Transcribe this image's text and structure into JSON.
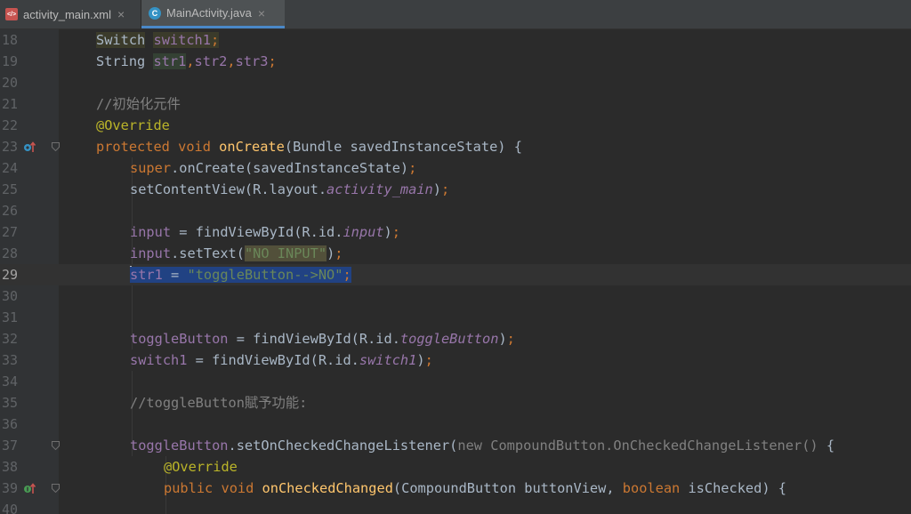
{
  "tabs": [
    {
      "label": "activity_main.xml",
      "icon": "xml-file-icon",
      "close": "×",
      "active": false
    },
    {
      "label": "MainActivity.java",
      "icon": "java-class-icon",
      "close": "×",
      "active": true
    }
  ],
  "editor": {
    "language": "java",
    "current_line": 29,
    "colors": {
      "background": "#2b2b2b",
      "keyword": "#cc7832",
      "field": "#9876aa",
      "method": "#ffc66d",
      "string": "#6a8759",
      "annotation": "#bbb529",
      "comment": "#808080",
      "selection": "#214283"
    },
    "lines": [
      {
        "n": "18",
        "t": [
          "Switch",
          " ",
          "switch1",
          ";"
        ]
      },
      {
        "n": "19",
        "t": [
          "String ",
          "str1",
          ",",
          "str2",
          ",",
          "str3",
          ";"
        ]
      },
      {
        "n": "20",
        "t": []
      },
      {
        "n": "21",
        "t": [
          "//初始化元件"
        ]
      },
      {
        "n": "22",
        "t": [
          "@Override"
        ]
      },
      {
        "n": "23",
        "t": [
          "protected",
          " ",
          "void",
          " ",
          "onCreate",
          "(Bundle savedInstanceState) {"
        ],
        "gutter_icon": "override-up-arrow-icon"
      },
      {
        "n": "24",
        "t": [
          "super",
          ".onCreate(savedInstanceState)",
          ";"
        ]
      },
      {
        "n": "25",
        "t": [
          "setContentView(R.layout.",
          "activity_main",
          ")",
          ";"
        ]
      },
      {
        "n": "26",
        "t": []
      },
      {
        "n": "27",
        "t": [
          "input",
          " = findViewById(R.id.",
          "input",
          ")",
          ";"
        ]
      },
      {
        "n": "28",
        "t": [
          "input",
          ".setText(",
          "\"NO INPUT\"",
          ")",
          ";"
        ]
      },
      {
        "n": "29",
        "t": [
          "str1",
          " = ",
          "\"toggleButton-->NO\"",
          ";"
        ]
      },
      {
        "n": "30",
        "t": []
      },
      {
        "n": "31",
        "t": []
      },
      {
        "n": "32",
        "t": [
          "toggleButton",
          " = findViewById(R.id.",
          "toggleButton",
          ")",
          ";"
        ]
      },
      {
        "n": "33",
        "t": [
          "switch1",
          " = findViewById(R.id.",
          "switch1",
          ")",
          ";"
        ]
      },
      {
        "n": "34",
        "t": []
      },
      {
        "n": "35",
        "t": [
          "//toggleButton賦予功能:"
        ]
      },
      {
        "n": "36",
        "t": []
      },
      {
        "n": "37",
        "t": [
          "toggleButton",
          ".setOnCheckedChangeListener(",
          "new CompoundButton.OnCheckedChangeListener()",
          " {"
        ]
      },
      {
        "n": "38",
        "t": [
          "@Override"
        ]
      },
      {
        "n": "39",
        "t": [
          "public",
          " ",
          "void",
          " ",
          "onCheckedChanged",
          "(CompoundButton buttonView, ",
          "boolean",
          " isChecked) {"
        ],
        "gutter_icon": "implements-up-arrow-icon"
      },
      {
        "n": "40",
        "t": []
      }
    ]
  }
}
